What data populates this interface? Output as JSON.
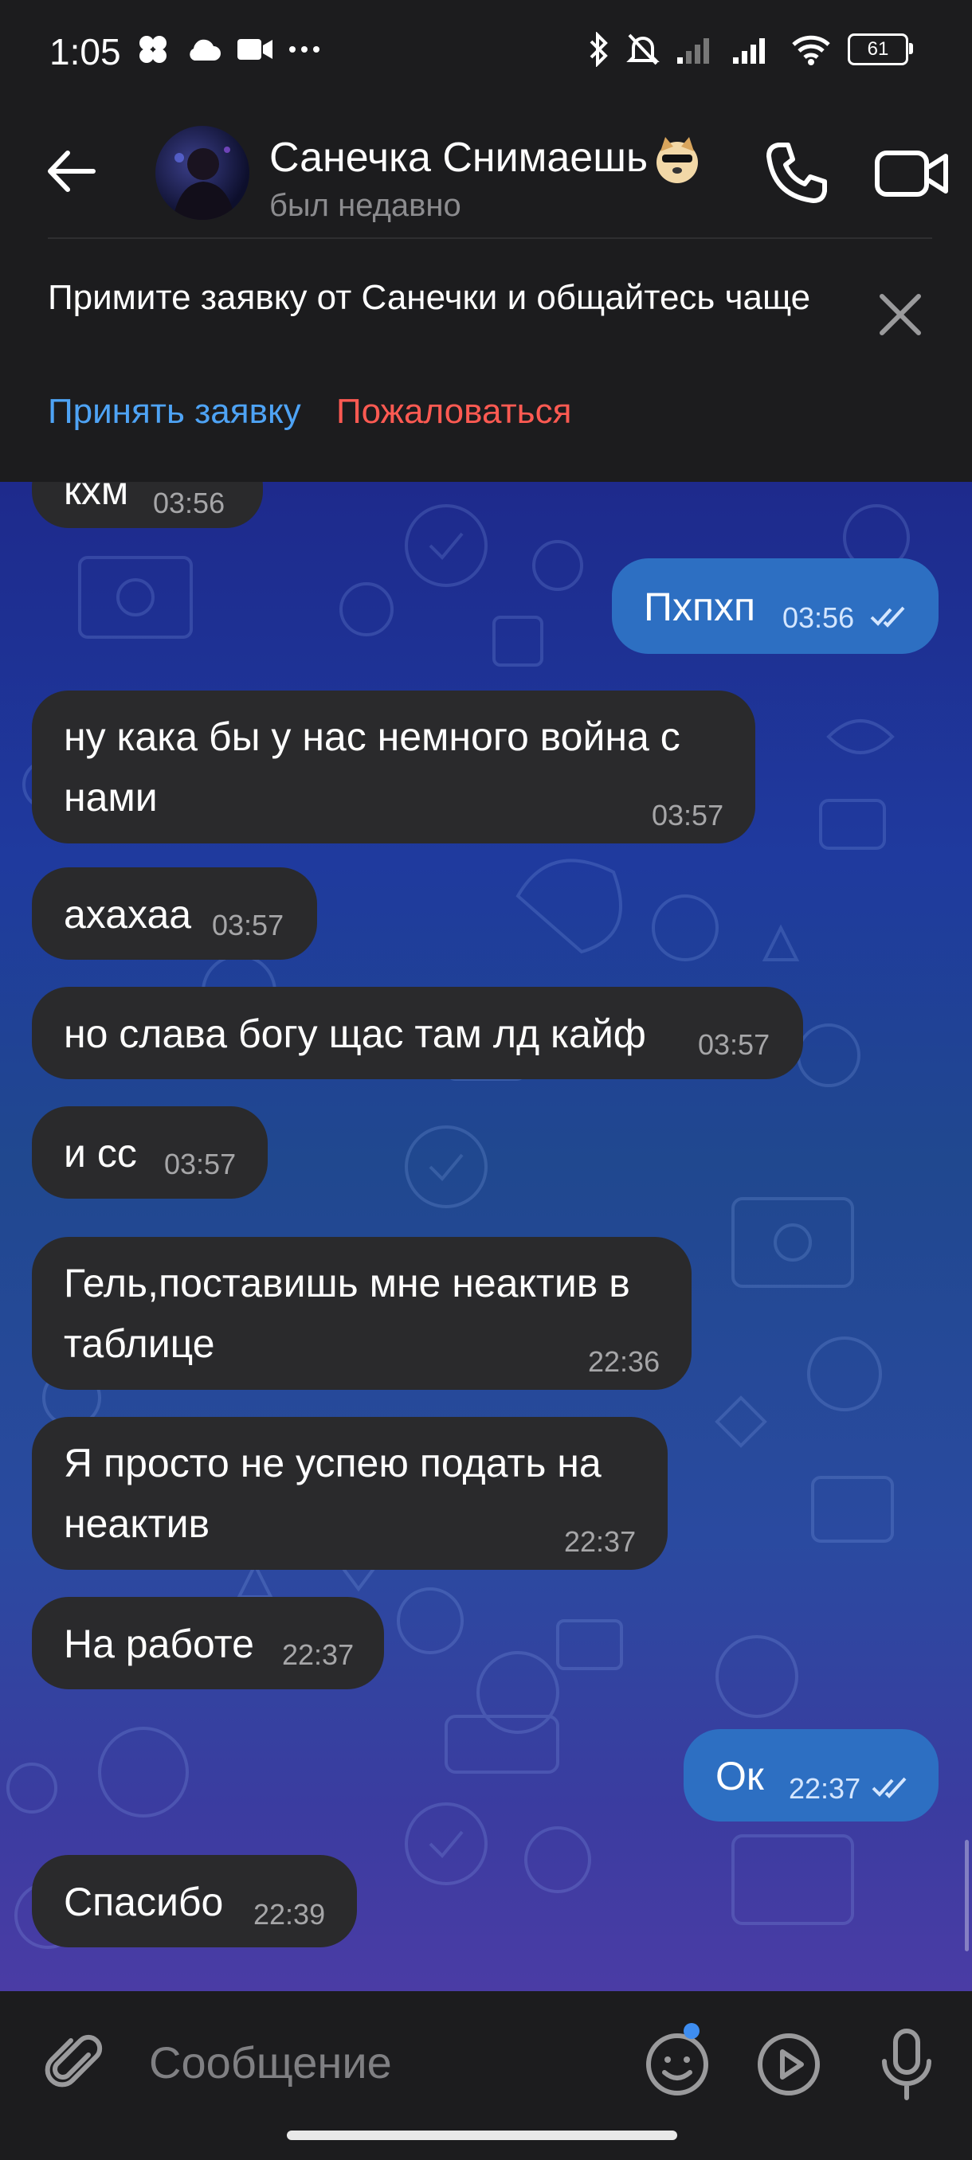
{
  "status_bar": {
    "time": "1:05",
    "battery": "61"
  },
  "header": {
    "contact_name": "Санечка Снимаешь",
    "last_seen": "был недавно"
  },
  "banner": {
    "text": "Примите заявку от Санечки и общайтесь чаще",
    "accept_label": "Принять заявку",
    "report_label": "Пожаловаться"
  },
  "messages": [
    {
      "dir": "in",
      "text": "кхм",
      "time": "03:56"
    },
    {
      "dir": "out",
      "text": "Пхпхп",
      "time": "03:56",
      "read": true
    },
    {
      "dir": "in",
      "text": "ну кака бы у нас немного война с нами",
      "time": "03:57"
    },
    {
      "dir": "in",
      "text": "ахахаа",
      "time": "03:57"
    },
    {
      "dir": "in",
      "text": "но слава богу щас там лд кайф",
      "time": "03:57"
    },
    {
      "dir": "in",
      "text": "и сс",
      "time": "03:57"
    },
    {
      "dir": "in",
      "text": "Гель,поставишь мне неактив в таблице",
      "time": "22:36"
    },
    {
      "dir": "in",
      "text": "Я просто не успею подать на неактив",
      "time": "22:37"
    },
    {
      "dir": "in",
      "text": "На работе",
      "time": "22:37"
    },
    {
      "dir": "out",
      "text": "Ок",
      "time": "22:37",
      "read": true
    },
    {
      "dir": "in",
      "text": "Спасибо",
      "time": "22:39"
    }
  ],
  "composer": {
    "placeholder": "Сообщение"
  },
  "colors": {
    "accent": "#4ea3f5",
    "danger": "#ff5a52",
    "outgoing_bubble": "#2d6fc2",
    "incoming_bubble": "#2a2a2c"
  }
}
